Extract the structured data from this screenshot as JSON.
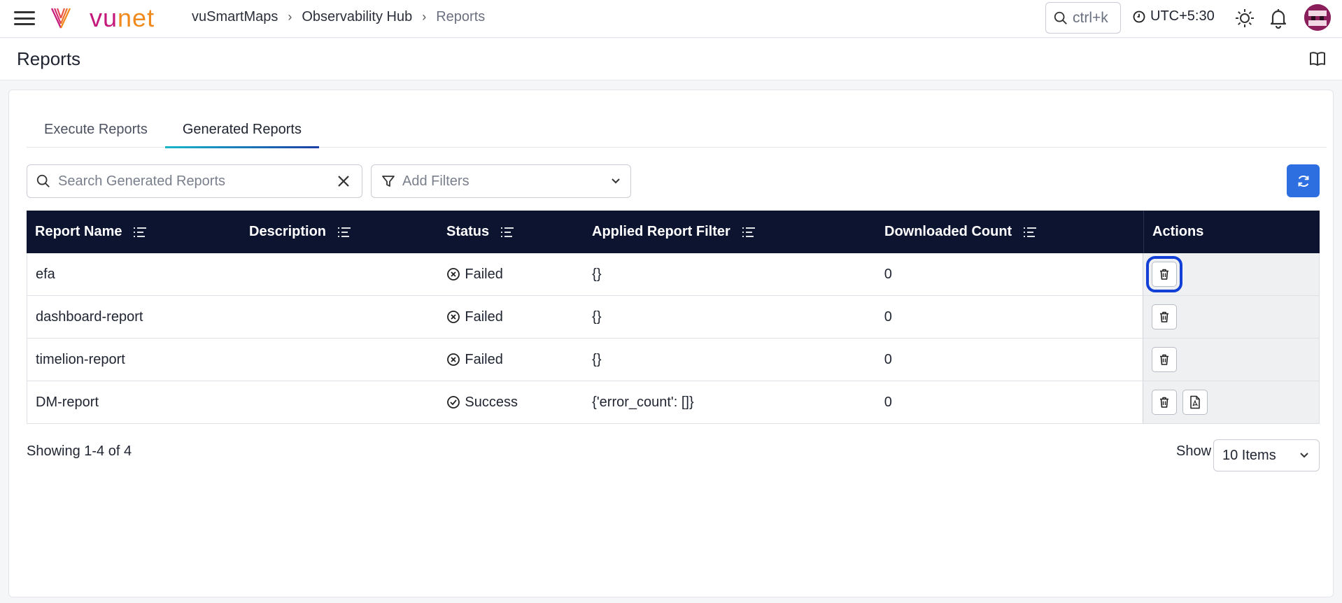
{
  "header": {
    "logo": {
      "vu": "vu",
      "net": "net"
    },
    "breadcrumb": [
      "vuSmartMaps",
      "Observability Hub",
      "Reports"
    ],
    "search_shortcut": "ctrl+k",
    "timezone": "UTC+5:30"
  },
  "page": {
    "title": "Reports"
  },
  "tabs": [
    {
      "label": "Execute Reports",
      "active": false
    },
    {
      "label": "Generated Reports",
      "active": true
    }
  ],
  "search": {
    "placeholder": "Search Generated Reports",
    "value": ""
  },
  "filters": {
    "label": "Add Filters"
  },
  "table": {
    "columns": [
      "Report Name",
      "Description",
      "Status",
      "Applied Report Filter",
      "Downloaded Count",
      "Actions"
    ],
    "rows": [
      {
        "name": "efa",
        "description": "",
        "status": "Failed",
        "filter": "{}",
        "downloaded": "0",
        "actions": [
          "delete-icon"
        ]
      },
      {
        "name": "dashboard-report",
        "description": "",
        "status": "Failed",
        "filter": "{}",
        "downloaded": "0",
        "actions": [
          "delete-icon"
        ]
      },
      {
        "name": "timelion-report",
        "description": "",
        "status": "Failed",
        "filter": "{}",
        "downloaded": "0",
        "actions": [
          "delete-icon"
        ]
      },
      {
        "name": "DM-report",
        "description": "",
        "status": "Success",
        "filter": "{'error_count': []}",
        "downloaded": "0",
        "actions": [
          "delete-icon",
          "pdf-download-icon"
        ]
      }
    ]
  },
  "pagination": {
    "summary": "Showing 1-4 of 4",
    "show_label": "Show",
    "page_size": "10 Items"
  },
  "colors": {
    "accent": "#2d6fe0",
    "table_header": "#0d1430",
    "brand_vu": "#c4197a",
    "brand_net": "#f08a1c",
    "highlight": "#1240d6"
  }
}
